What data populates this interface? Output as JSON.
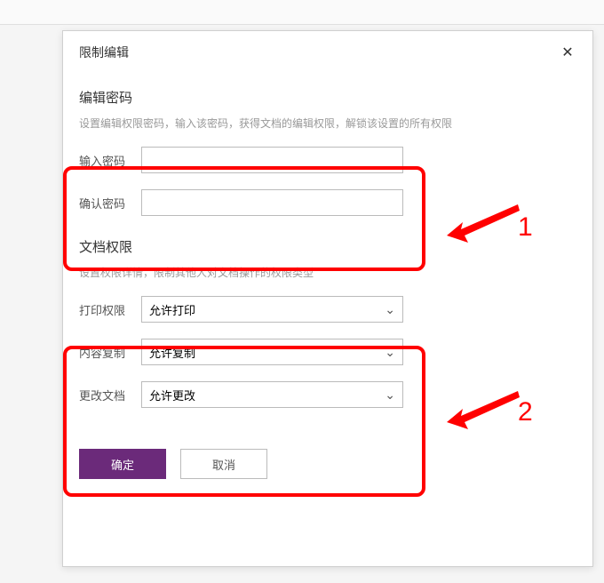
{
  "dialog": {
    "title": "限制编辑",
    "section1": {
      "title": "编辑密码",
      "desc": "设置编辑权限密码，输入该密码，获得文档的编辑权限，解锁该设置的所有权限",
      "input_pw_label": "输入密码",
      "confirm_pw_label": "确认密码"
    },
    "section2": {
      "title": "文档权限",
      "desc": "设置权限详情，限制其他人对文档操作的权限类型",
      "print_label": "打印权限",
      "print_value": "允许打印",
      "copy_label": "内容复制",
      "copy_value": "允许复制",
      "modify_label": "更改文档",
      "modify_value": "允许更改"
    },
    "ok_label": "确定",
    "cancel_label": "取消"
  },
  "annotations": {
    "num1": "1",
    "num2": "2"
  }
}
